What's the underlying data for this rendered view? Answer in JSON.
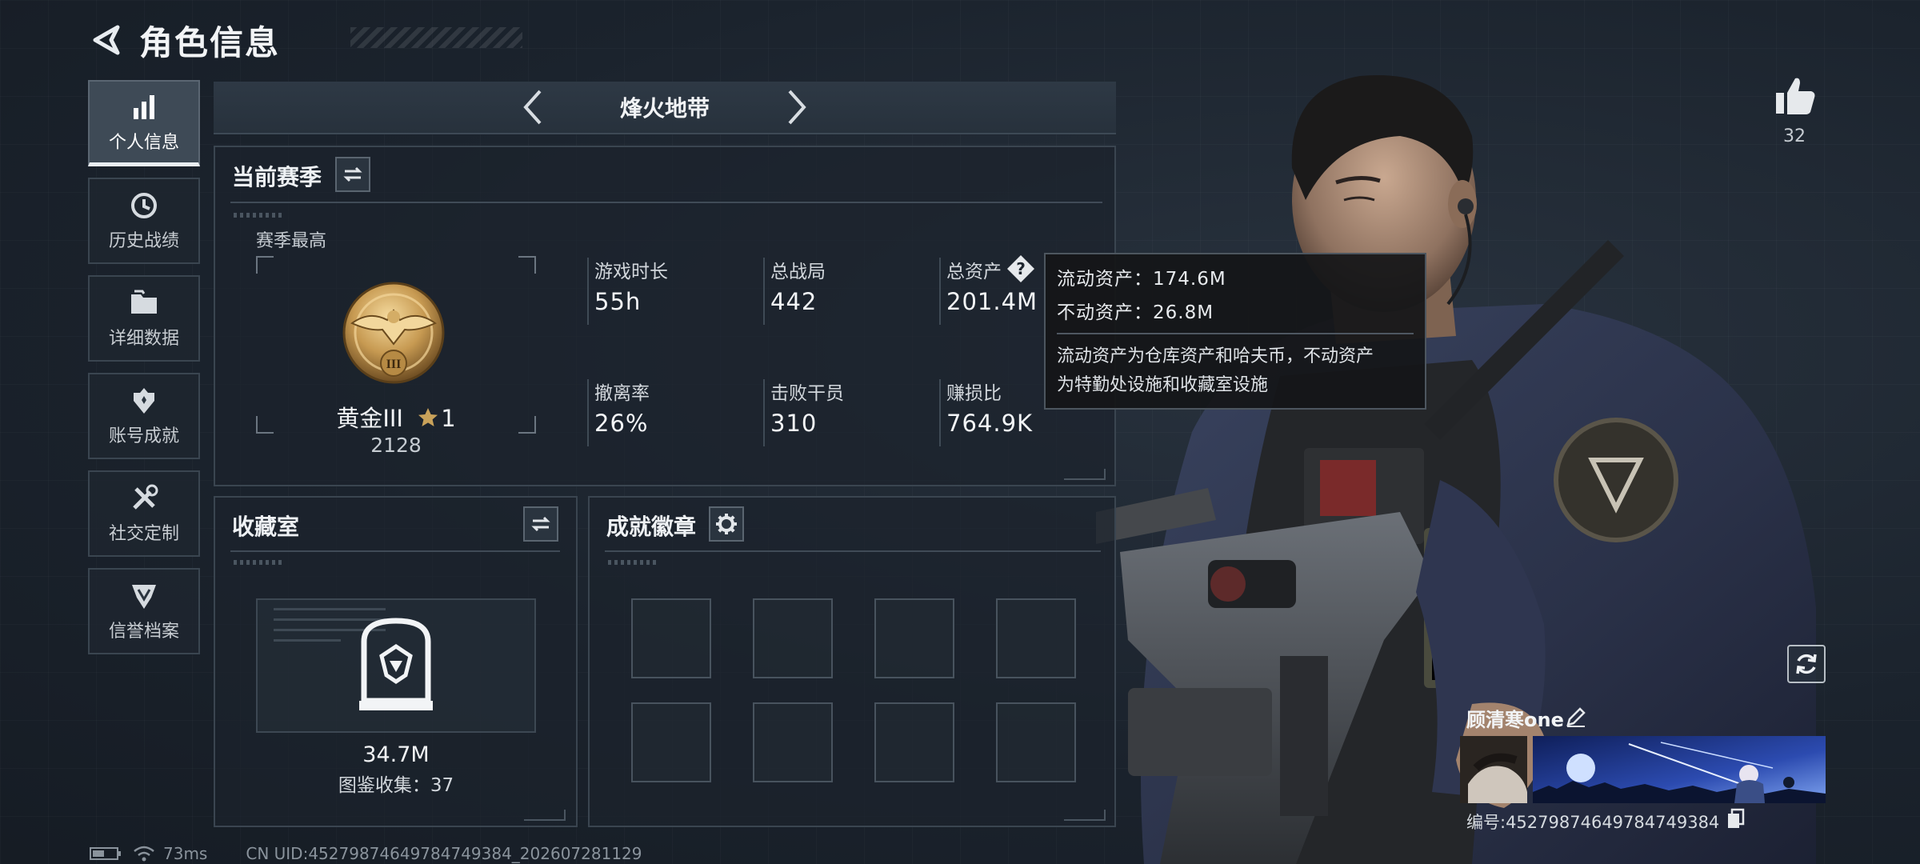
{
  "header": {
    "title": "角色信息"
  },
  "sidebar": {
    "items": [
      {
        "label": "个人信息",
        "icon": "bar-chart-icon",
        "active": true
      },
      {
        "label": "历史战绩",
        "icon": "history-icon",
        "active": false
      },
      {
        "label": "详细数据",
        "icon": "folder-icon",
        "active": false
      },
      {
        "label": "账号成就",
        "icon": "achievement-icon",
        "active": false
      },
      {
        "label": "社交定制",
        "icon": "tools-icon",
        "active": false
      },
      {
        "label": "信誉档案",
        "icon": "shield-icon",
        "active": false
      }
    ]
  },
  "mode": {
    "name": "烽火地带"
  },
  "season": {
    "title": "当前赛季",
    "best_label": "赛季最高",
    "rank_name": "黄金III",
    "rank_stars": "1",
    "rank_badge_numeral": "III",
    "rank_score": "2128",
    "stats": [
      {
        "label": "游戏时长",
        "value": "55h"
      },
      {
        "label": "总战局",
        "value": "442"
      },
      {
        "label": "总资产",
        "value": "201.4M"
      },
      {
        "label": "撤离率",
        "value": "26%"
      },
      {
        "label": "击败干员",
        "value": "310"
      },
      {
        "label": "赚损比",
        "value": "764.9K"
      }
    ]
  },
  "tooltip": {
    "liquid": "流动资产：174.6M",
    "fixed": "不动资产：26.8M",
    "desc_line1": "流动资产为仓库资产和哈夫币，不动资产",
    "desc_line2": "为特勤处设施和收藏室设施"
  },
  "collection": {
    "title": "收藏室",
    "value": "34.7M",
    "catalog": "图鉴收集：37"
  },
  "badges": {
    "title": "成就徽章",
    "slots": 8
  },
  "like": {
    "count": "32"
  },
  "player": {
    "name": "顾清寒one",
    "id": "编号:4527987464978474938​4"
  },
  "status": {
    "ping": "73ms",
    "uid": "CN UID:45279874649784749384_202607281129"
  },
  "colors": {
    "accent": "#e9eef2",
    "panel_border": "#3a4550",
    "background": "#1b232d",
    "gold": "#c9a25a"
  }
}
